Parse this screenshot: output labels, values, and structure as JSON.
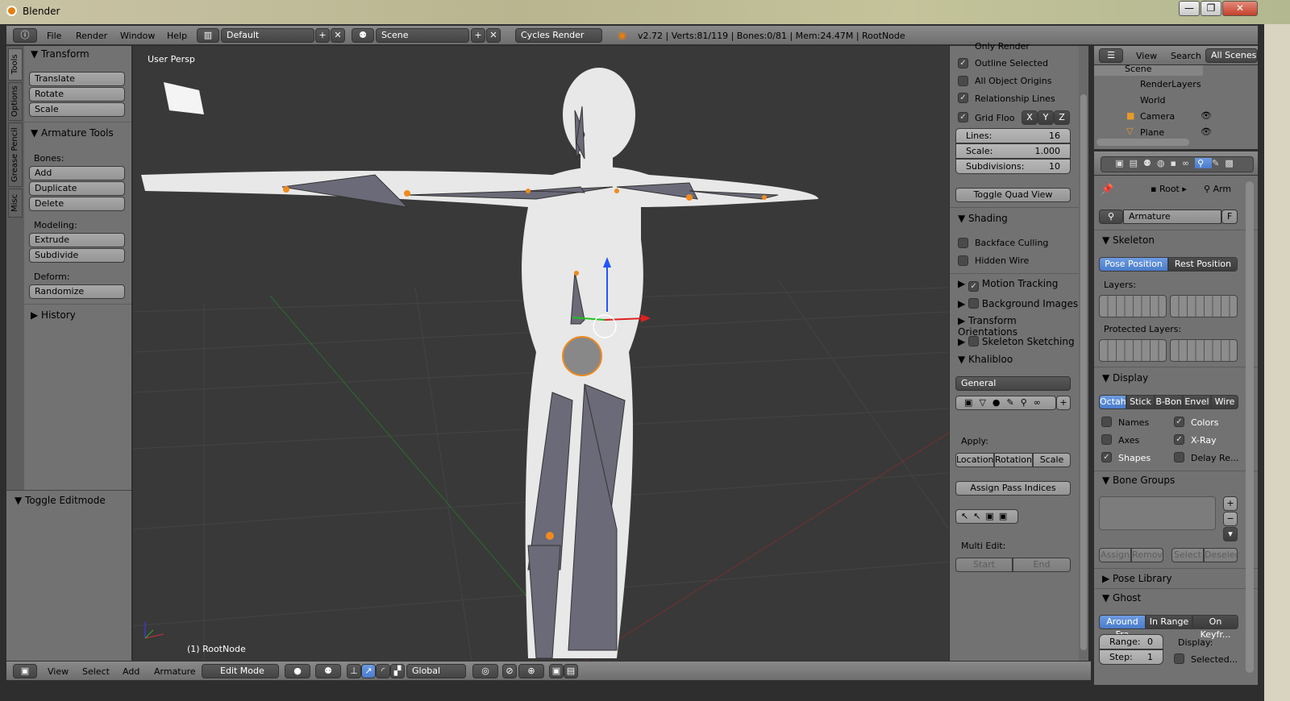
{
  "window": {
    "title": "Blender",
    "minimize": "—",
    "maximize": "❐",
    "close": "✕"
  },
  "top": {
    "menus": [
      "File",
      "Render",
      "Window",
      "Help"
    ],
    "layout": "Default",
    "scene": "Scene",
    "engine": "Cycles Render",
    "status": "v2.72 | Verts:81/119 | Bones:0/81 | Mem:24.47M | RootNode"
  },
  "tabs": [
    "Tools",
    "Options",
    "Grease Pencil",
    "Misc"
  ],
  "tools": {
    "transform": "Transform",
    "translate": "Translate",
    "rotate": "Rotate",
    "scale": "Scale",
    "armature_tools": "Armature Tools",
    "bones": "Bones:",
    "add": "Add",
    "duplicate": "Duplicate",
    "delete": "Delete",
    "modeling": "Modeling:",
    "extrude": "Extrude",
    "subdivide": "Subdivide",
    "deform": "Deform:",
    "randomize": "Randomize",
    "history": "History",
    "toggle_editmode": "Toggle Editmode"
  },
  "viewport": {
    "label": "User Persp",
    "object": "(1) RootNode"
  },
  "npanel": {
    "only_render": "Only Render",
    "outline_selected": "Outline Selected",
    "all_object_origins": "All Object Origins",
    "relationship_lines": "Relationship Lines",
    "grid_floor": "Grid Floo",
    "x": "X",
    "y": "Y",
    "z": "Z",
    "lines_label": "Lines:",
    "lines": "16",
    "scale_label": "Scale:",
    "scale": "1.000",
    "subdiv_label": "Subdivisions:",
    "subdiv": "10",
    "toggle_quad": "Toggle Quad View",
    "shading": "Shading",
    "backface": "Backface Culling",
    "hidden_wire": "Hidden Wire",
    "motion_tracking": "Motion Tracking",
    "background_images": "Background Images",
    "transform_orientations": "Transform Orientations",
    "skeleton_sketching": "Skeleton Sketching",
    "khalibloo": "Khalibloo",
    "general": "General",
    "apply": "Apply:",
    "location": "Location",
    "rotation": "Rotation",
    "scale_btn": "Scale",
    "assign_pass": "Assign Pass Indices",
    "multi_edit": "Multi Edit:",
    "start": "Start",
    "end": "End"
  },
  "outliner": {
    "view": "View",
    "search": "Search",
    "filter": "All Scenes",
    "items": [
      "Scene",
      "RenderLayers",
      "World",
      "Camera",
      "Plane"
    ]
  },
  "props": {
    "root": "Root",
    "arm": "Arm",
    "datablock": "Armature",
    "fake": "F",
    "skeleton": "Skeleton",
    "pose_position": "Pose Position",
    "rest_position": "Rest Position",
    "layers": "Layers:",
    "protected_layers": "Protected Layers:",
    "display": "Display",
    "display_modes": [
      "Octah",
      "Stick",
      "B-Bon",
      "Envel",
      "Wire"
    ],
    "names": "Names",
    "colors": "Colors",
    "axes": "Axes",
    "xray": "X-Ray",
    "shapes": "Shapes",
    "delay": "Delay Re...",
    "bone_groups": "Bone Groups",
    "assign": "Assign",
    "remove": "Remov",
    "select": "Select",
    "deselect": "Deselec",
    "pose_library": "Pose Library",
    "ghost": "Ghost",
    "ghost_modes": [
      "Around Fra",
      "In Range",
      "On Keyfr..."
    ],
    "range_label": "Range:",
    "range": "0",
    "step_label": "Step:",
    "step": "1",
    "display_label": "Display:",
    "selected": "Selected..."
  },
  "bottom": {
    "menus": [
      "View",
      "Select",
      "Add",
      "Armature"
    ],
    "mode": "Edit Mode",
    "orientation": "Global"
  },
  "colors": {
    "viewport": "#393939",
    "panel": "#727272",
    "selected": "#5680c2",
    "bone": "#6a6a78",
    "active_joint": "#f08a1e"
  }
}
